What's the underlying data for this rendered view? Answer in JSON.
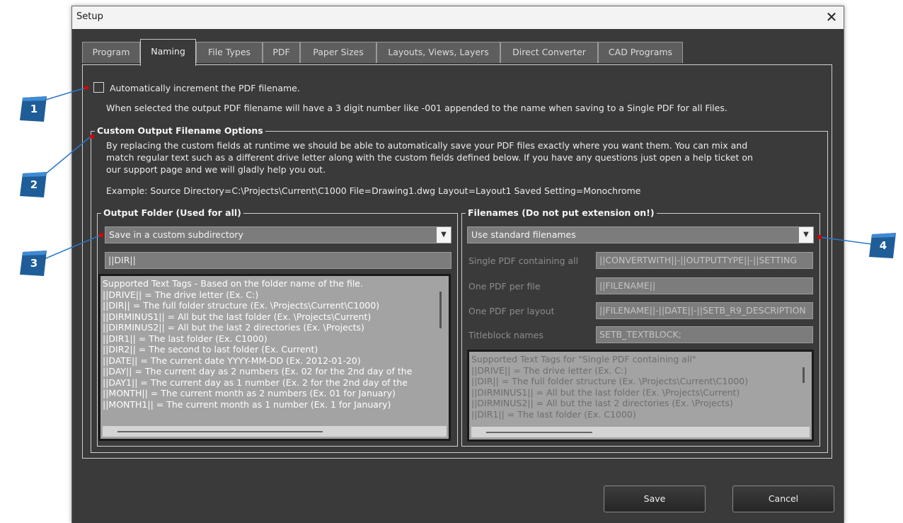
{
  "window": {
    "title": "Setup",
    "close_glyph": "✕"
  },
  "tabs": [
    {
      "label": "Program",
      "active": false
    },
    {
      "label": "Naming",
      "active": true
    },
    {
      "label": "File Types",
      "active": false
    },
    {
      "label": "PDF",
      "active": false
    },
    {
      "label": "Paper Sizes",
      "active": false
    },
    {
      "label": "Layouts, Views, Layers",
      "active": false
    },
    {
      "label": "Direct Converter",
      "active": false
    },
    {
      "label": "CAD Programs",
      "active": false
    }
  ],
  "auto_increment": {
    "label": "Automatically increment the PDF filename.",
    "checked": false,
    "description": "When selected the output PDF filename will have a 3 digit number like -001 appended to the name when saving to a Single PDF for all Files."
  },
  "custom_options": {
    "heading": "Custom Output Filename Options",
    "description_lines": [
      "By replacing the custom fields at runtime we should be able to automatically save your PDF files exactly where you want them.  You can mix and",
      "match regular text such as a different drive letter along with the custom fields defined below.  If you have any questions just open a help ticket on",
      "our support page and we will gladly help you out."
    ],
    "example": "Example: Source Directory=C:\\Projects\\Current\\C1000   File=Drawing1.dwg   Layout=Layout1  Saved Setting=Monochrome"
  },
  "output_folder": {
    "heading": "Output Folder (Used for all)",
    "mode": "Save in a custom subdirectory",
    "path": "||DIR||",
    "tags": [
      "Supported Text Tags - Based on the folder name of the file.",
      "||DRIVE|| = The drive letter (Ex. C:)",
      "||DIR|| = The full folder structure (Ex. \\Projects\\Current\\C1000)",
      "||DIRMINUS1|| = All but the last folder (Ex. \\Projects\\Current)",
      "||DIRMINUS2|| = All but the last 2 directories (Ex. \\Projects)",
      "||DIR1|| = The last folder (Ex. C1000)",
      "||DIR2|| = The second to last folder (Ex. Current)",
      "||DATE|| = The current date YYYY-MM-DD (Ex. 2012-01-20)",
      "||DAY|| = The current day as 2 numbers (Ex. 02 for the 2nd day of the",
      "||DAY1|| = The current day as 1 number (Ex. 2 for the 2nd day of the",
      "||MONTH|| = The current month as 2 numbers (Ex. 01 for January)",
      "||MONTH1|| = The current month as 1 number (Ex. 1 for January)"
    ]
  },
  "filenames": {
    "heading": "Filenames (Do not put extension on!)",
    "mode": "Use standard filenames",
    "rows": [
      {
        "label": "Single PDF containing all",
        "value": "||CONVERTWITH||-||OUTPUTTYPE||-||SETTING"
      },
      {
        "label": "One PDF per file",
        "value": "||FILENAME||"
      },
      {
        "label": "One PDF per layout",
        "value": "||FILENAME||-||DATE||-||SETB_R9_DESCRIPTION"
      },
      {
        "label": "Titleblock names",
        "value": "SETB_TEXTBLOCK;"
      }
    ],
    "tags": [
      "Supported Text Tags for \"Single PDF containing all\"",
      "||DRIVE|| = The drive letter (Ex. C:)",
      "||DIR|| = The full folder structure (Ex. \\Projects\\Current\\C1000)",
      "||DIRMINUS1|| = All but the last folder (Ex. \\Projects\\Current)",
      "||DIRMINUS2|| = All but the last 2 directories (Ex. \\Projects)",
      "||DIR1|| = The last folder (Ex. C1000)"
    ]
  },
  "buttons": {
    "save": "Save",
    "cancel": "Cancel"
  },
  "callouts": [
    "1",
    "2",
    "3",
    "4"
  ],
  "colors": {
    "dialog_bg": "#3a3a3a",
    "callout_blue": "#1f5d98",
    "marker_red": "#e00000"
  }
}
